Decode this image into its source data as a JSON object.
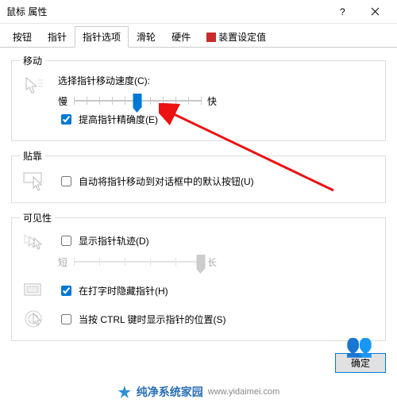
{
  "window": {
    "title": "鼠标 属性"
  },
  "tabs": [
    {
      "label": "按钮"
    },
    {
      "label": "指针"
    },
    {
      "label": "指针选项"
    },
    {
      "label": "滑轮"
    },
    {
      "label": "硬件"
    },
    {
      "label": "装置设定值",
      "has_icon": true
    }
  ],
  "active_tab_index": 2,
  "groups": {
    "motion": {
      "legend": "移动",
      "speed_label": "选择指针移动速度(C):",
      "slow": "慢",
      "fast": "快",
      "speed_value": 5,
      "speed_min": 0,
      "speed_max": 10,
      "enhance_checked": true,
      "enhance_label": "提高指针精确度(E)"
    },
    "snap": {
      "legend": "贴靠",
      "snap_checked": false,
      "snap_label": "自动将指针移动到对话框中的默认按钮(U)"
    },
    "visibility": {
      "legend": "可见性",
      "trail_checked": false,
      "trail_label": "显示指针轨迹(D)",
      "trail_short": "短",
      "trail_long": "长",
      "trail_value": 10,
      "trail_min": 0,
      "trail_max": 10,
      "hide_checked": true,
      "hide_label": "在打字时隐藏指针(H)",
      "ctrl_checked": false,
      "ctrl_label": "当按 CTRL 键时显示指针的位置(S)"
    }
  },
  "buttons": {
    "ok": "确定"
  },
  "watermark": {
    "brand": "纯净系统家园",
    "url": "www.yidaimei.com"
  }
}
